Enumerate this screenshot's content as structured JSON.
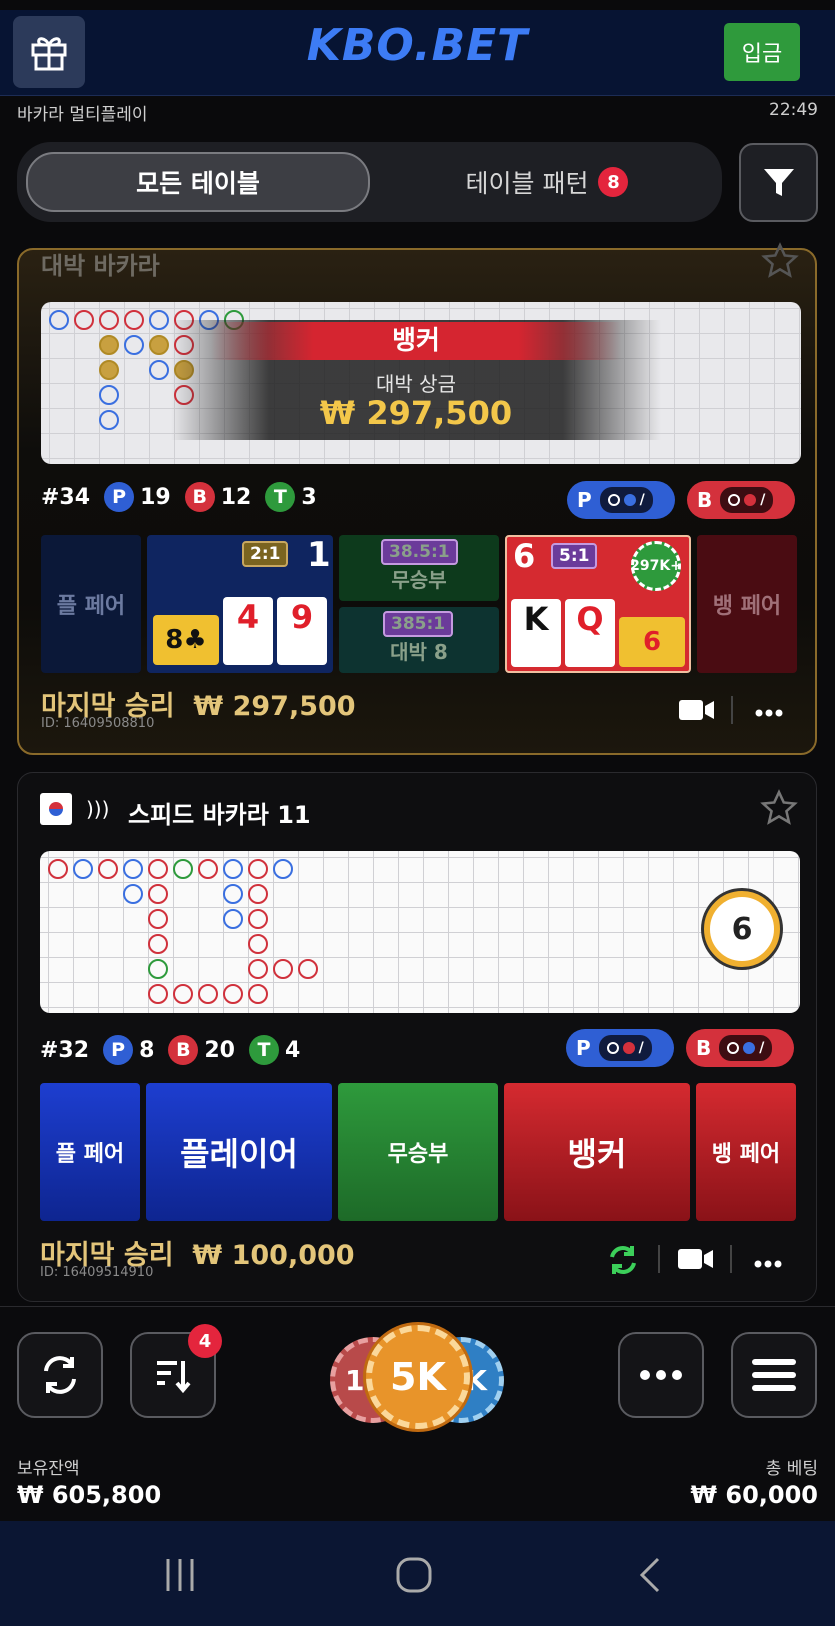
{
  "header": {
    "logo": "KBO.BET",
    "deposit_label": "입금",
    "subtitle": "바카라 멀티플레이",
    "time": "22:49"
  },
  "tabs": {
    "all_label": "모든 테이블",
    "pattern_label": "테이블 패턴",
    "pattern_badge": "8"
  },
  "table1": {
    "name": "대박 바카라",
    "overlay_winner": "뱅커",
    "overlay_prize_label": "대박 상금",
    "overlay_prize": "₩ 297,500",
    "round": "#34",
    "p_count": "19",
    "b_count": "12",
    "t_count": "3",
    "p_label": "P",
    "b_label": "B",
    "t_label": "T",
    "bets": {
      "player_pair": "플 페어",
      "player_ratio": "2:1",
      "player_score": "1",
      "tie_ratio": "38.5:1",
      "tie_label": "무승부",
      "jackpot_ratio": "385:1",
      "jackpot_label": "대박 8",
      "banker_score": "6",
      "banker_ratio": "5:1",
      "banker_chip": "297K+",
      "banker_pair": "뱅 페어"
    },
    "player_cards": [
      "8♣",
      "4",
      "9"
    ],
    "banker_cards": [
      "K",
      "Q",
      "6"
    ],
    "last_win_label": "마지막 승리",
    "last_win": "₩ 297,500",
    "id": "ID: 16409508810"
  },
  "table2": {
    "name": "스피드 바카라 11",
    "timer": "6",
    "round": "#32",
    "p_count": "8",
    "b_count": "20",
    "t_count": "4",
    "p_label": "P",
    "b_label": "B",
    "t_label": "T",
    "bets": {
      "player_pair": "플 페어",
      "player": "플레이어",
      "tie": "무승부",
      "banker": "뱅커",
      "banker_pair": "뱅 페어"
    },
    "last_win_label": "마지막 승리",
    "last_win": "₩ 100,000",
    "id": "ID: 16409514910"
  },
  "bottom": {
    "sort_badge": "4",
    "chip_selected": "5K",
    "chip_left": "1",
    "chip_right": "K",
    "balance_label": "보유잔액",
    "balance": "₩ 605,800",
    "total_bet_label": "총 베팅",
    "total_bet": "₩ 60,000"
  },
  "colors": {
    "player": "#2f5fd4",
    "banker": "#d4313c",
    "tie": "#2e9a3c",
    "gold": "#e3c57a",
    "deposit": "#2f9a3c"
  }
}
